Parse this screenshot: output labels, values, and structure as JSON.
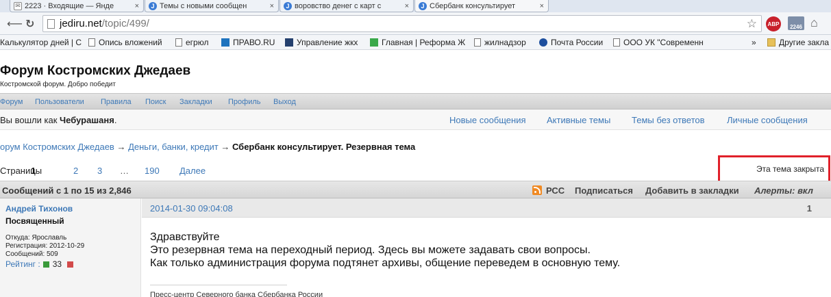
{
  "browser": {
    "tabs": [
      {
        "label": "2223 · Входящие — Янде",
        "icon": "mail-icon"
      },
      {
        "label": "Темы с новыми сообщен",
        "icon": "J"
      },
      {
        "label": "воровство денег с карт с",
        "icon": "J"
      },
      {
        "label": "Сбербанк консультирует",
        "icon": "J"
      }
    ],
    "close_glyph": "×",
    "url_domain": "jediru.net",
    "url_path": "/topic/499/",
    "abp_label": "ABP",
    "mail_count": "2246",
    "bookmarks": [
      {
        "label": "Калькулятор дней | С",
        "icon": "none"
      },
      {
        "label": "Опись вложений",
        "icon": "doc"
      },
      {
        "label": "егрюл",
        "icon": "doc"
      },
      {
        "label": "ПРАВО.RU",
        "icon": "pravo"
      },
      {
        "label": "Управление жкх",
        "icon": "zhkh"
      },
      {
        "label": "Главная | Реформа Ж",
        "icon": "reform"
      },
      {
        "label": "жилнадзор",
        "icon": "doc"
      },
      {
        "label": "Почта России",
        "icon": "post"
      },
      {
        "label": "ООО УК \"Современн",
        "icon": "doc"
      }
    ],
    "bookmarks_more": "»",
    "other_bookmarks": "Другие закла"
  },
  "forum": {
    "title": "Форум Костромских Джедаев",
    "description": "Костромской форум. Добро победит",
    "menu": [
      "Форум",
      "Пользователи",
      "Правила",
      "Поиск",
      "Закладки",
      "Профиль",
      "Выход"
    ],
    "welcome_prefix": "Вы вошли как ",
    "username": "Чебурашаня",
    "welcome_suffix": ".",
    "quick_links": [
      "Новые сообщения",
      "Активные темы",
      "Темы без ответов",
      "Личные сообщения"
    ]
  },
  "breadcrumb": {
    "root": "орум Костромских Джедаев",
    "sep": "→",
    "section": "Деньги, банки, кредит",
    "current": "Сбербанк консультирует. Резервная тема"
  },
  "pagination": {
    "label": "Страницы",
    "pages": [
      "1",
      "2",
      "3",
      "…",
      "190"
    ],
    "next": "Далее"
  },
  "topic_closed": "Эта тема закрыта",
  "postbar": {
    "count": "Сообщений с 1 по 15 из 2,846",
    "rss": "РСС",
    "subscribe": "Подписаться",
    "bookmark": "Добавить в закладки",
    "alerts": "Алерты: вкл"
  },
  "post": {
    "author": "Андрей Тихонов",
    "rank": "Посвященный",
    "from": "Откуда: Ярославль",
    "registered": "Регистрация: 2012-10-29",
    "messages": "Сообщений: 509",
    "rating_label": "Рейтинг :",
    "rating_value": "33",
    "date": "2014-01-30 09:04:08",
    "number": "1",
    "lines": [
      "Здравствуйте",
      "Это резервная тема на переходный период. Здесь вы можете задавать свои вопросы.",
      "Как только администрация форума подтянет архивы, общение переведем в основную тему."
    ],
    "signature": "Пресс-центр Северного банка Сбербанка России"
  }
}
